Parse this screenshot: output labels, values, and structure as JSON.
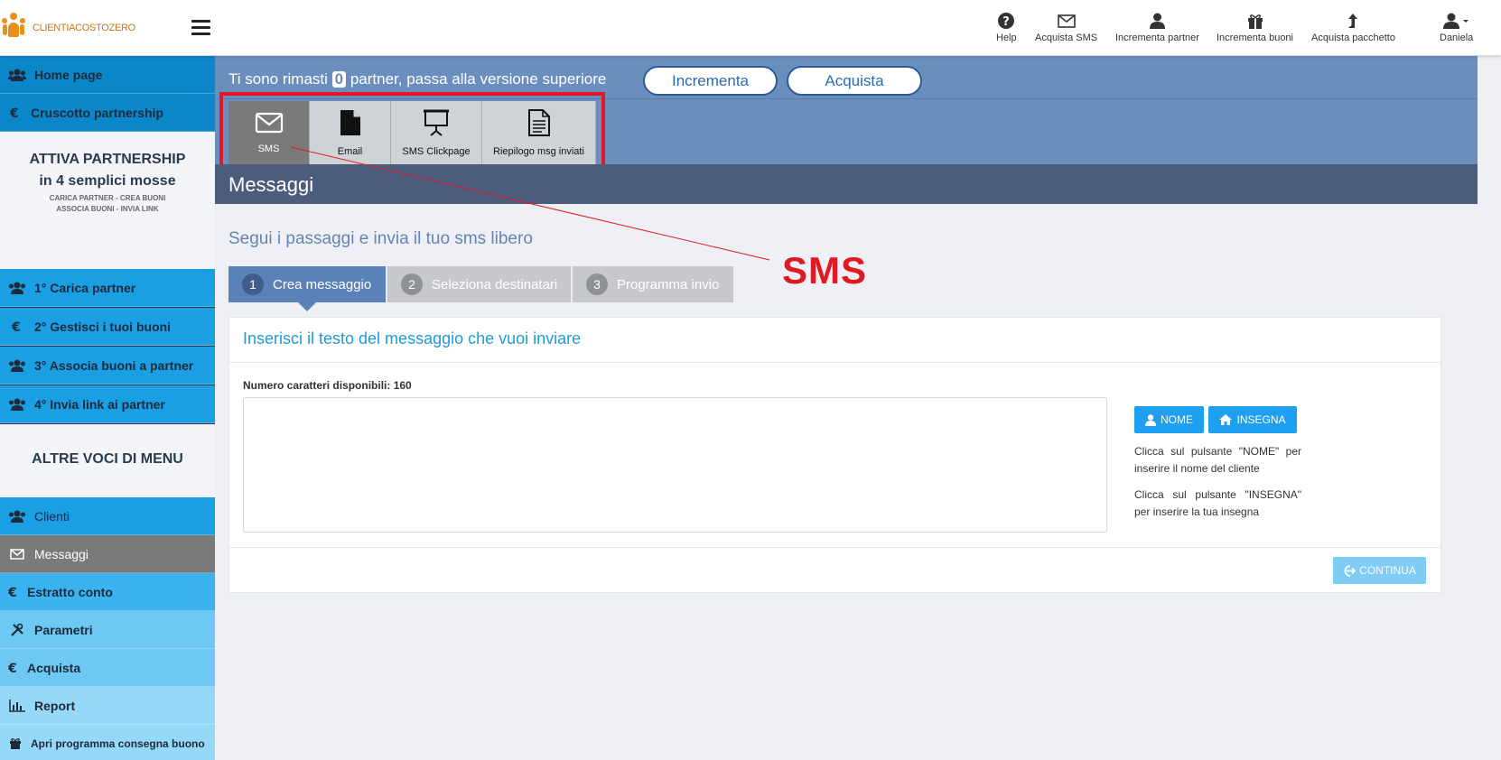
{
  "header": {
    "logo_text": "CLIENTIACOSTOZERO",
    "nav": [
      {
        "label": "Help",
        "icon": "question-circle-icon"
      },
      {
        "label": "Acquista SMS",
        "icon": "envelope-icon"
      },
      {
        "label": "Incrementa partner",
        "icon": "user-icon"
      },
      {
        "label": "Incrementa buoni",
        "icon": "gift-icon"
      },
      {
        "label": "Acquista pacchetto",
        "icon": "arrow-up-icon"
      }
    ],
    "user": "Daniela"
  },
  "sidebar": {
    "items_top": [
      {
        "label": "Home page",
        "icon": "users-icon"
      },
      {
        "label": "Cruscotto partnership",
        "icon": "euro-icon"
      }
    ],
    "activate": {
      "title1": "ATTIVA PARTNERSHIP",
      "title2": "in 4 semplici mosse",
      "line1": "CARICA PARTNER - CREA BUONI",
      "line2": "ASSOCIA BUONI - INVIA LINK"
    },
    "steps": [
      {
        "label": "1°   Carica partner",
        "icon": "users-icon"
      },
      {
        "label": "2°    Gestisci i tuoi buoni",
        "icon": "euro-icon"
      },
      {
        "label": "3°   Associa buoni a partner",
        "icon": "users-icon"
      },
      {
        "label": "4°   Invia link ai partner",
        "icon": "users-icon"
      }
    ],
    "other_title": "ALTRE VOCI DI MENU",
    "items_other": [
      {
        "label": "Clienti",
        "icon": "users-icon"
      },
      {
        "label": "Messaggi",
        "icon": "envelope-icon"
      },
      {
        "label": "Estratto conto",
        "icon": "euro-icon"
      },
      {
        "label": "Parametri",
        "icon": "tools-icon"
      },
      {
        "label": "Acquista",
        "icon": "euro-icon"
      },
      {
        "label": "Report",
        "icon": "bar-chart-icon"
      },
      {
        "label": "Apri programma consegna buono",
        "icon": "gift-icon"
      }
    ]
  },
  "banner": {
    "text_before": "Ti sono rimasti ",
    "count": "0",
    "text_after": " partner, passa alla versione superiore",
    "btn_incrementa": "Incrementa",
    "btn_acquista": "Acquista"
  },
  "toolbar": [
    {
      "label": "SMS",
      "icon": "envelope-icon"
    },
    {
      "label": "Email",
      "icon": "file-icon"
    },
    {
      "label": "SMS Clickpage",
      "icon": "presentation-icon"
    },
    {
      "label": "Riepilogo msg inviati",
      "icon": "document-icon"
    }
  ],
  "page_title": "Messaggi",
  "subtitle": "Segui i passaggi e invia il tuo sms libero",
  "wizard": [
    {
      "num": "1",
      "label": "Crea messaggio"
    },
    {
      "num": "2",
      "label": "Seleziona destinatari"
    },
    {
      "num": "3",
      "label": "Programma invio"
    }
  ],
  "panel": {
    "title": "Inserisci il testo del messaggio che vuoi inviare",
    "count_label": "Numero caratteri disponibili: 160",
    "message_value": "",
    "btn_nome": "NOME",
    "btn_insegna": "INSEGNA",
    "help1": "Clicca sul pulsante \"NOME\" per inserire il nome del cliente",
    "help2": "Clicca sul pulsante \"INSEGNA\" per inserire la tua insegna",
    "btn_continua": "CONTINUA"
  },
  "annotation": "SMS",
  "colors": {
    "sidebar_blue_1": "#0b86c9",
    "sidebar_blue_2": "#1a9ee4",
    "sidebar_blue_3": "#3bb3ef",
    "sidebar_blue_4": "#6ec8f4",
    "sidebar_blue_5": "#96d8f8",
    "sidebar_active": "#7a7a7a",
    "banner": "#6a8fbf",
    "title_bar": "#4b5c7c",
    "accent": "#1e9ff0",
    "annotation_red": "#e01a22"
  }
}
